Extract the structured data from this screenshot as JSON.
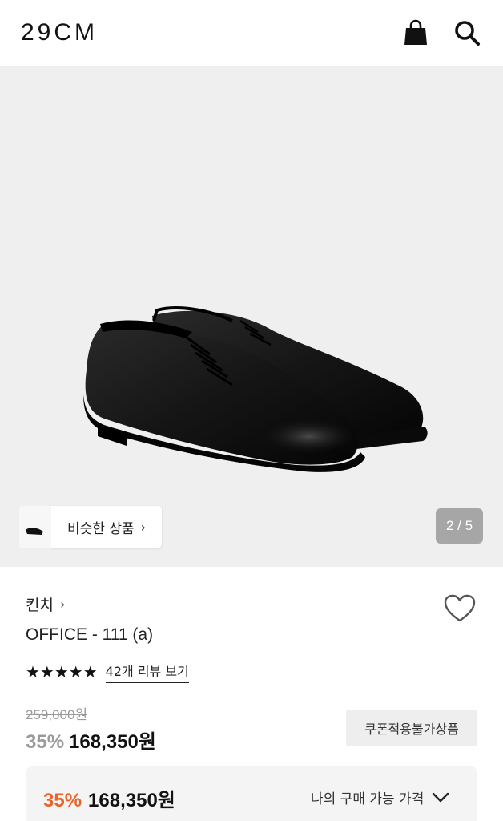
{
  "header": {
    "logo": "29CM",
    "bag_icon": "shopping-bag-icon",
    "search_icon": "search-icon"
  },
  "hero": {
    "similar_label": "비슷한 상품",
    "similar_chevron": "›",
    "pager": "2 / 5"
  },
  "product": {
    "brand": "킨치",
    "brand_chevron": "›",
    "title": "OFFICE - 111 (a)",
    "stars": "★★★★★",
    "review_link": "42개 리뷰 보기",
    "original_price": "259,000원",
    "discount": "35%",
    "price": "168,350원",
    "coupon_badge": "쿠폰적용불가상품"
  },
  "purchase": {
    "discount": "35%",
    "price": "168,350원",
    "my_price_label": "나의 구매 가능 가격"
  },
  "colors": {
    "accent_orange": "#e8642a",
    "grey_text": "#9a9a9a"
  }
}
